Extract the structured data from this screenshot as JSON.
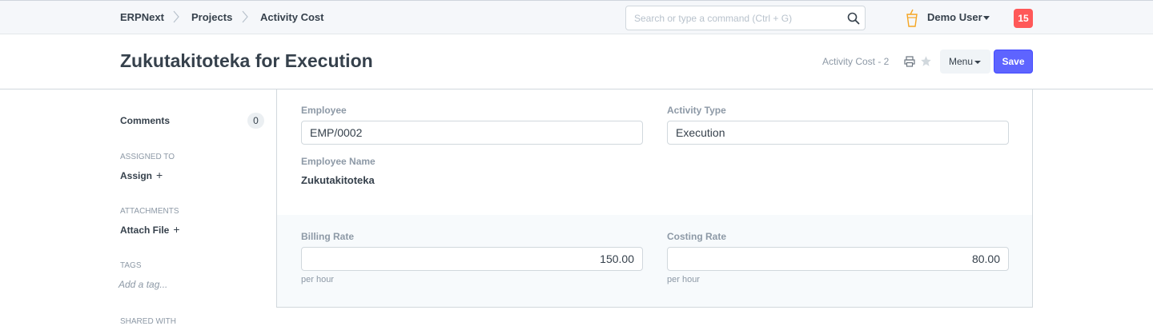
{
  "navbar": {
    "breadcrumbs": [
      "ERPNext",
      "Projects",
      "Activity Cost"
    ],
    "search_placeholder": "Search or type a command (Ctrl + G)",
    "user_name": "Demo User",
    "notification_count": "15"
  },
  "page_head": {
    "title": "Zukutakitoteka for Execution",
    "indicator": "Activity Cost - 2",
    "menu_label": "Menu",
    "save_label": "Save"
  },
  "sidebar": {
    "comments_label": "Comments",
    "comments_count": "0",
    "assigned_to_label": "ASSIGNED TO",
    "assign_label": "Assign",
    "attachments_label": "ATTACHMENTS",
    "attach_file_label": "Attach File",
    "tags_label": "TAGS",
    "add_tag_label": "Add a tag...",
    "shared_with_label": "SHARED WITH"
  },
  "form": {
    "employee_label": "Employee",
    "employee_value": "EMP/0002",
    "activity_type_label": "Activity Type",
    "activity_type_value": "Execution",
    "employee_name_label": "Employee Name",
    "employee_name_value": "Zukutakitoteka",
    "billing_rate_label": "Billing Rate",
    "billing_rate_value": "150.00",
    "billing_rate_desc": "per hour",
    "costing_rate_label": "Costing Rate",
    "costing_rate_value": "80.00",
    "costing_rate_desc": "per hour"
  },
  "colors": {
    "primary": "#5e64ff",
    "notification": "#ff5858",
    "text": "#36414c",
    "muted": "#8d99a6"
  },
  "icons": [
    "chevron-right-icon",
    "search-icon",
    "user-cup-icon",
    "caret-down-icon",
    "print-icon",
    "star-icon",
    "plus-icon"
  ]
}
